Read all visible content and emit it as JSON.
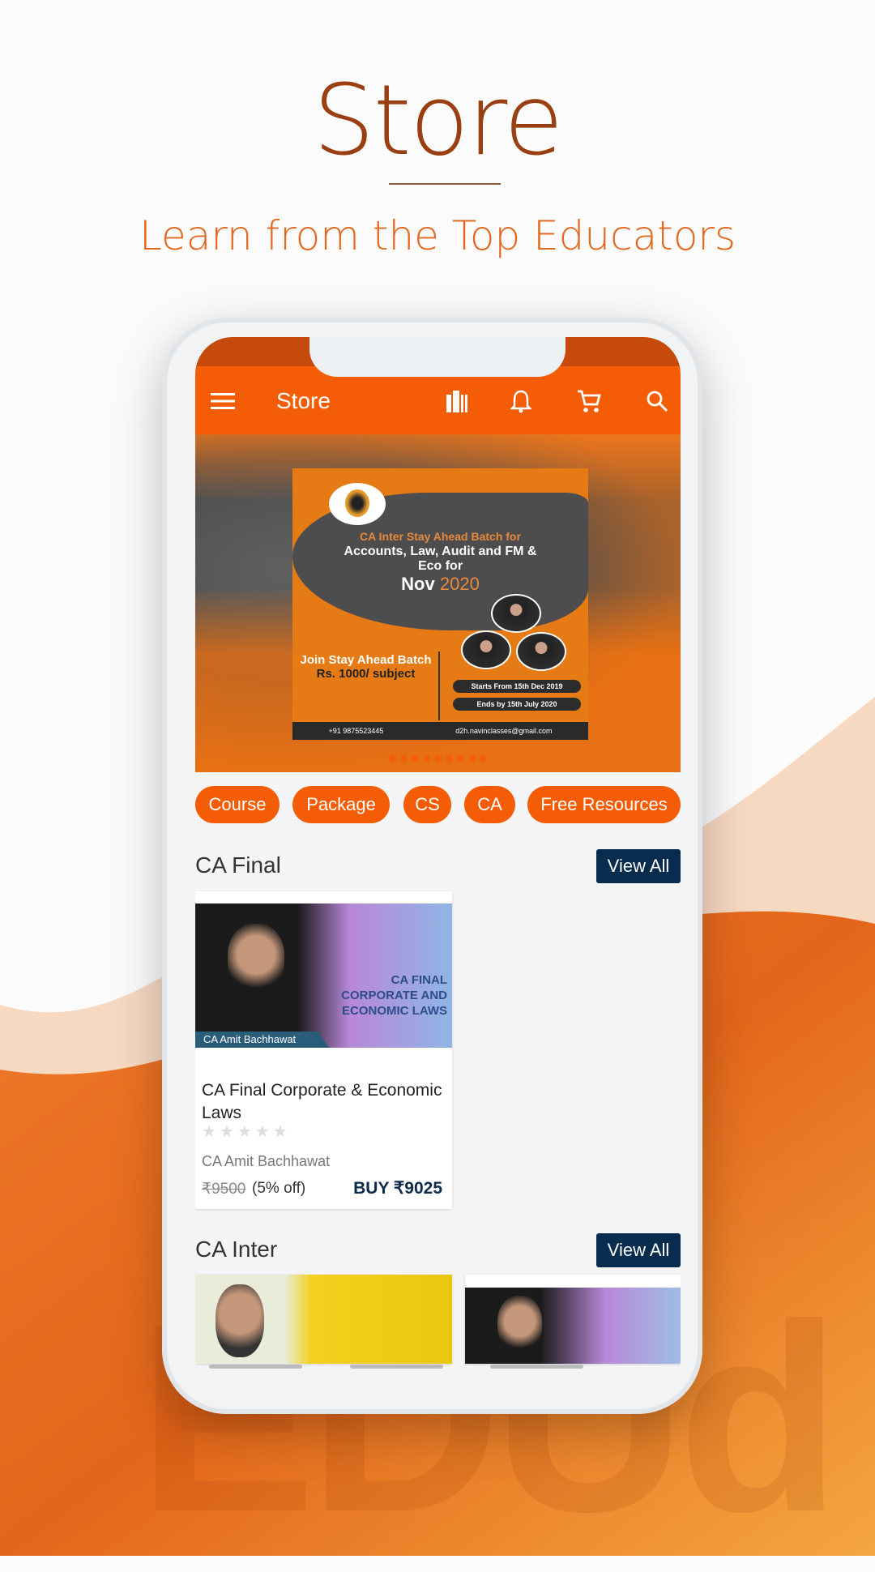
{
  "hero": {
    "title": "Store",
    "subtitle": "Learn from the Top Educators",
    "watermark": "EDUd"
  },
  "colors": {
    "accent": "#f45d05",
    "title": "#9a3f12",
    "dark_button": "#072c4e"
  },
  "appbar": {
    "title": "Store",
    "icons": [
      "menu-icon",
      "library-icon",
      "bell-icon",
      "cart-icon",
      "search-icon"
    ]
  },
  "banner": {
    "headline": "CA Inter Stay Ahead Batch for",
    "subjects": "Accounts, Law, Audit and FM & Eco for",
    "month": "Nov",
    "year": "2020",
    "offer_line1": "Join Stay Ahead Batch",
    "offer_price": "Rs. 1000/ subject",
    "starts": "Starts From 15th Dec 2019",
    "ends": "Ends by 15th July 2020",
    "phone": "+91 9875523445",
    "email": "d2h.navinclasses@gmail.com",
    "slide_count": 9,
    "active_slide": 1
  },
  "chips": [
    "Course",
    "Package",
    "CS",
    "CA",
    "Free Resources"
  ],
  "sections": [
    {
      "title": "CA Final",
      "view_all": "View All",
      "cards": [
        {
          "image_title": "CA FINAL CORPORATE AND ECONOMIC LAWS",
          "image_tag": "CA Amit Bachhawat",
          "title": "CA Final Corporate & Economic Laws",
          "rating": 0,
          "max_rating": 5,
          "author": "CA Amit Bachhawat",
          "original_price": "₹9500",
          "discount": "(5% off)",
          "buy": "BUY ₹9025"
        }
      ]
    },
    {
      "title": "CA Inter",
      "view_all": "View All"
    }
  ]
}
